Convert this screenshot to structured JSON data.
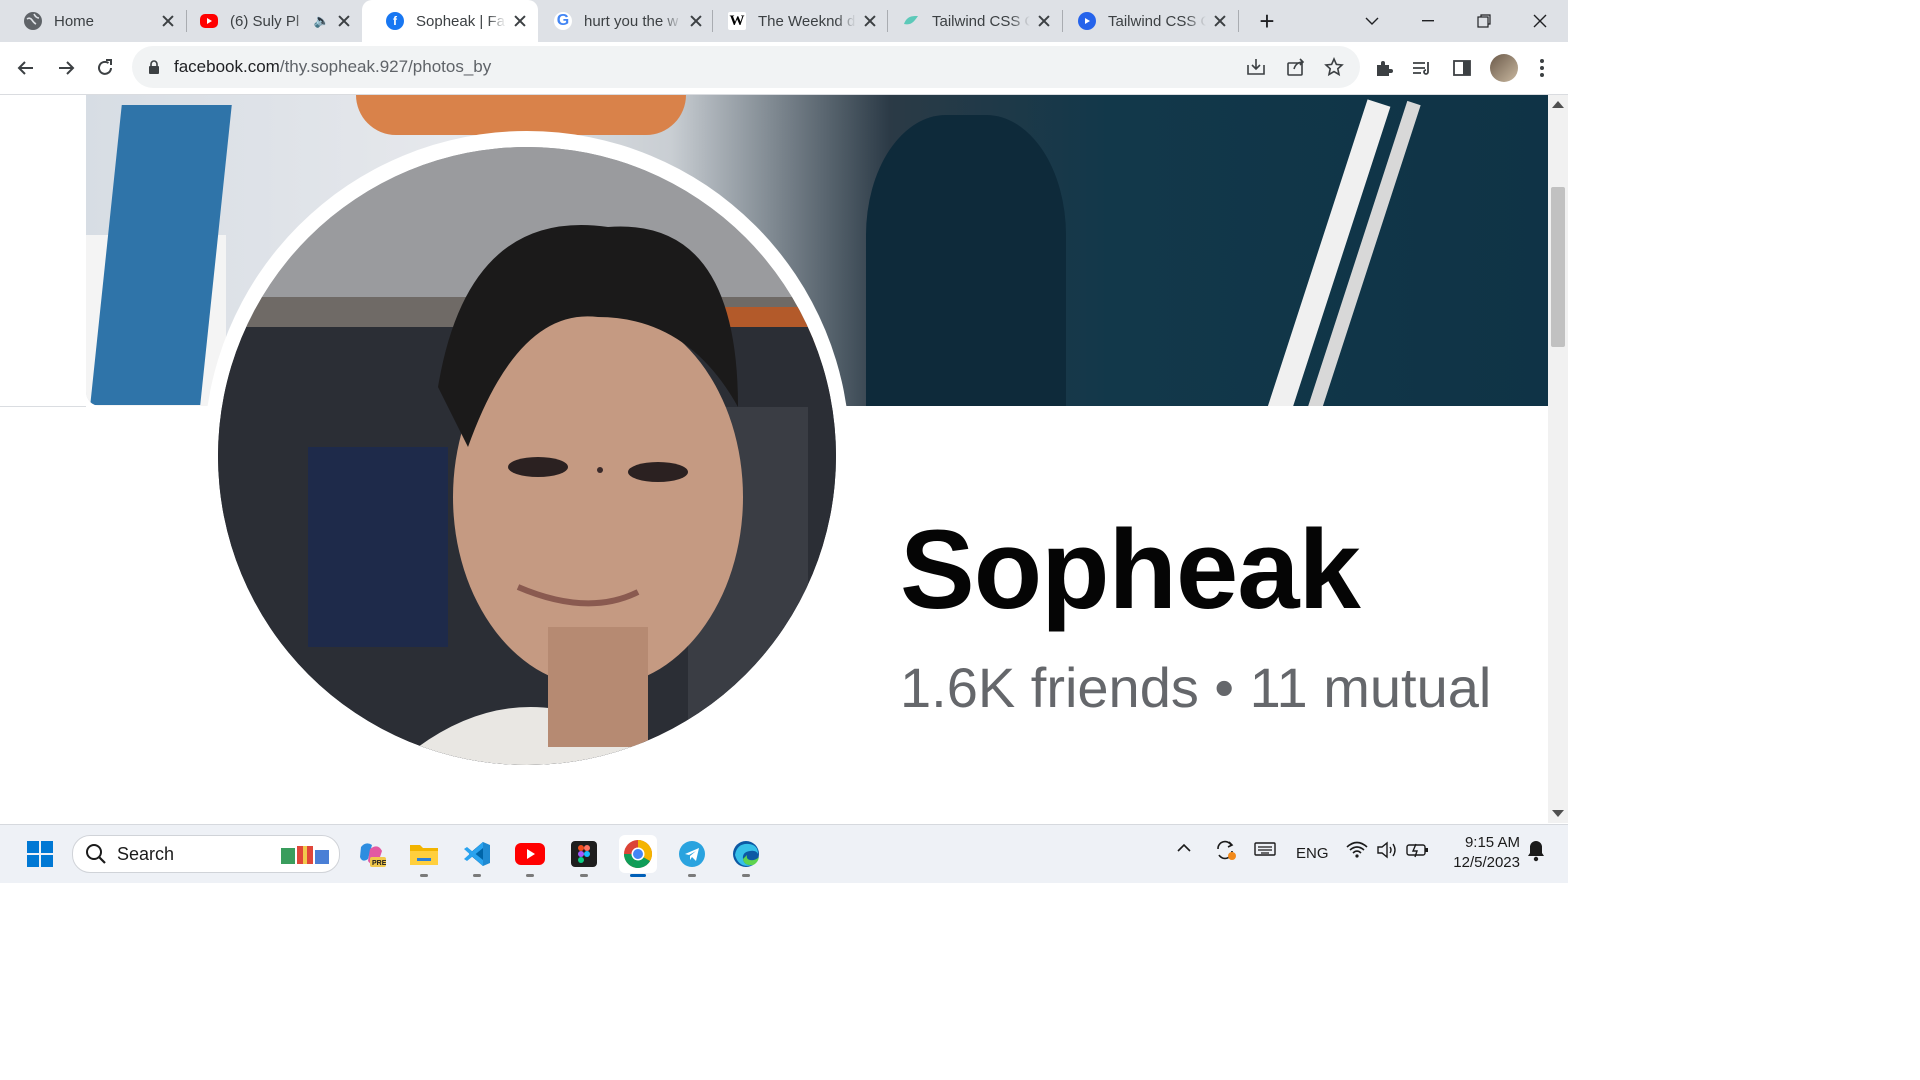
{
  "browser": {
    "tabs": [
      {
        "title": "Home",
        "icon": "globe-icon",
        "color": "#5f6368"
      },
      {
        "title": "(6) Suly Pl",
        "icon": "youtube-icon",
        "color": "#ff0000",
        "audio": true
      },
      {
        "title": "Sopheak | Fac",
        "icon": "facebook-icon",
        "color": "#1877f2",
        "active": true
      },
      {
        "title": "hurt you the w",
        "icon": "google-icon",
        "color": "#4285f4"
      },
      {
        "title": "The Weeknd d",
        "icon": "wikipedia-icon",
        "color": "#000000"
      },
      {
        "title": "Tailwind CSS C",
        "icon": "tailwind-icon",
        "color": "#38bdf8"
      },
      {
        "title": "Tailwind CSS C",
        "icon": "play-icon",
        "color": "#2563eb"
      }
    ],
    "url": {
      "host": "facebook.com",
      "path": "/thy.sopheak.927/photos_by"
    }
  },
  "profile": {
    "name": "Sopheak",
    "stats": "1.6K friends • 11 mutual"
  },
  "taskbar": {
    "search_placeholder": "Search",
    "apps": [
      "copilot-icon",
      "file-explorer-icon",
      "vscode-icon",
      "youtube-icon",
      "figma-icon",
      "chrome-icon",
      "telegram-icon",
      "edge-icon"
    ],
    "language": "ENG",
    "time": "9:15 AM",
    "date": "12/5/2023"
  },
  "colors": {
    "facebook_blue": "#1877f2",
    "name_text": "#050505",
    "secondary_text": "#65676b",
    "accent": "#005fb8"
  }
}
